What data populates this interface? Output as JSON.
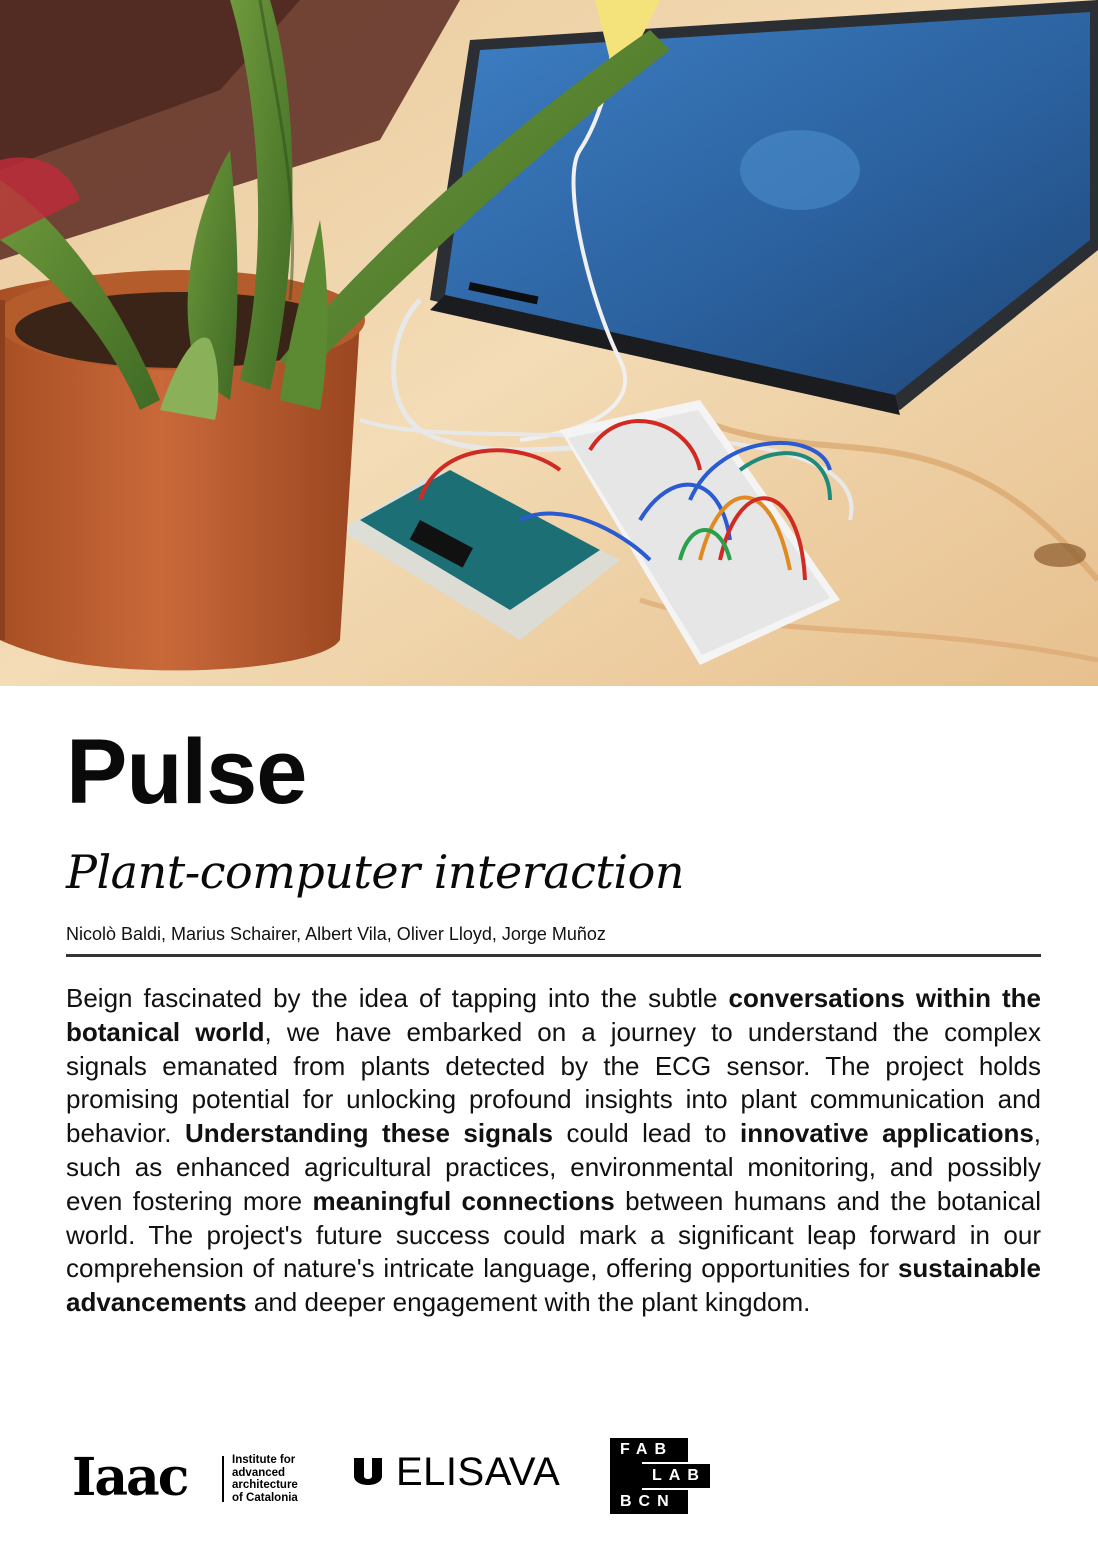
{
  "hero_image": {
    "alt": "Aloe plant in terracotta pot connected with wires to an Arduino board and breadboard next to a laptop"
  },
  "title": "Pulse",
  "subtitle": "Plant-computer interaction",
  "authors": "Nicolò Baldi, Marius Schairer, Albert Vila, Oliver Lloyd, Jorge Muñoz",
  "body": [
    {
      "t": "Beign fascinated by the idea of tapping into the subtle ",
      "b": false
    },
    {
      "t": "conversations within the botanical world",
      "b": true
    },
    {
      "t": ", we have embarked on a journey to understand the complex signals emanated from plants detected by the ECG sensor. The project holds promising potential for unlocking profound insights into plant communication and behavior. ",
      "b": false
    },
    {
      "t": "Understanding these signals",
      "b": true
    },
    {
      "t": " could lead to ",
      "b": false
    },
    {
      "t": "innovative applications",
      "b": true
    },
    {
      "t": ", such as enhanced agricultural practices, environmental monitoring, and possibly even fostering more ",
      "b": false
    },
    {
      "t": "meaningful connections",
      "b": true
    },
    {
      "t": " between humans and the botanical world. The project's future success could mark a significant leap forward in our comprehension of nature's intricate language, offering opportunities for ",
      "b": false
    },
    {
      "t": "sustainable advancements",
      "b": true
    },
    {
      "t": " and deeper engagement with the plant kingdom.",
      "b": false
    }
  ],
  "logos": {
    "iaac": {
      "mark": "Iaac",
      "lines": [
        "Institute for",
        "advanced",
        "architecture",
        "of Catalonia"
      ]
    },
    "elisava": {
      "word": "ELISAVA"
    },
    "fablab": {
      "rows": [
        "FAB",
        "LAB",
        "BCN"
      ]
    }
  }
}
